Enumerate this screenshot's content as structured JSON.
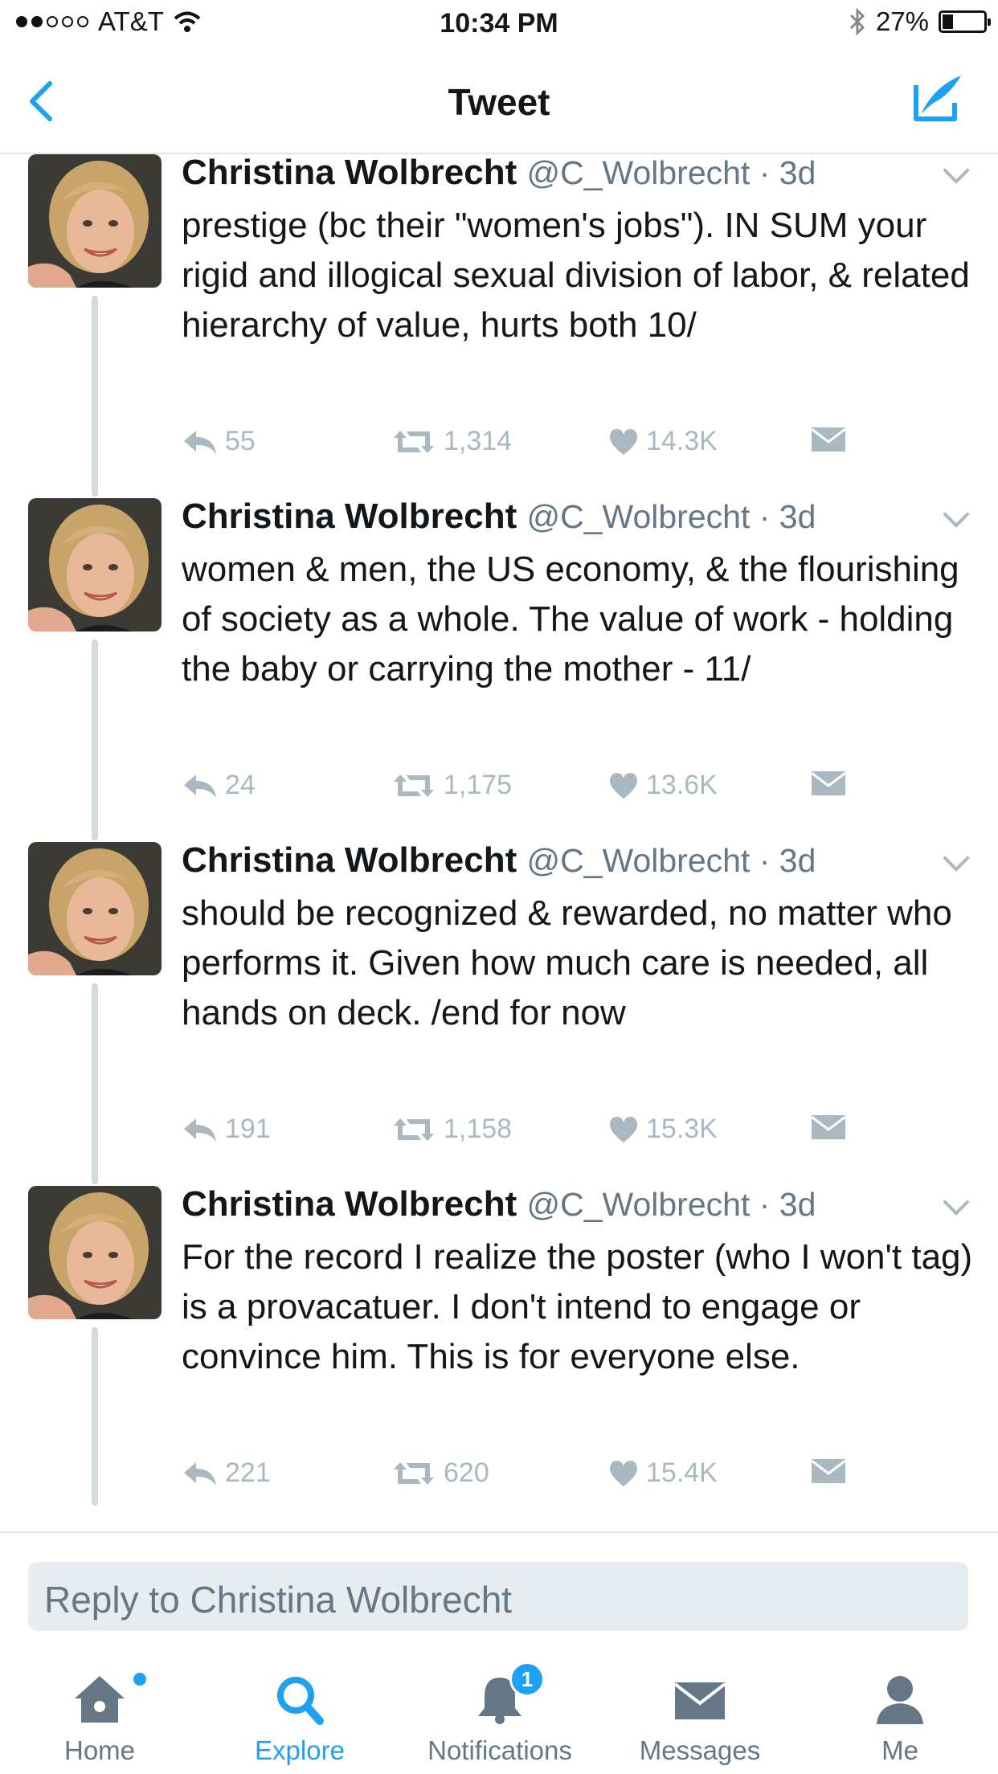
{
  "status_bar": {
    "carrier": "AT&T",
    "time": "10:34 PM",
    "battery": "27%"
  },
  "nav": {
    "title": "Tweet"
  },
  "tweets": [
    {
      "name": "Christina Wolbrecht",
      "handle": "@C_Wolbrecht",
      "time": "3d",
      "text": "prestige (bc their \"women's jobs\"). IN SUM your rigid and illogical sexual division of labor, & related hierarchy of value, hurts both 10/",
      "replies": "55",
      "retweets": "1,314",
      "likes": "14.3K"
    },
    {
      "name": "Christina Wolbrecht",
      "handle": "@C_Wolbrecht",
      "time": "3d",
      "text": "women & men, the US economy, & the flourishing of society as a whole. The value of work - holding the baby or carrying the mother - 11/",
      "replies": "24",
      "retweets": "1,175",
      "likes": "13.6K"
    },
    {
      "name": "Christina Wolbrecht",
      "handle": "@C_Wolbrecht",
      "time": "3d",
      "text": "should be recognized & rewarded, no matter who performs it. Given how much care is needed, all hands on deck. /end for now",
      "replies": "191",
      "retweets": "1,158",
      "likes": "15.3K"
    },
    {
      "name": "Christina Wolbrecht",
      "handle": "@C_Wolbrecht",
      "time": "3d",
      "text": "For the record I realize the poster (who I won't tag) is a provacatuer. I don't intend to engage or convince him. This is for everyone else.",
      "replies": "221",
      "retweets": "620",
      "likes": "15.4K"
    }
  ],
  "reply": {
    "placeholder": "Reply to Christina Wolbrecht"
  },
  "tab_bar": {
    "home": "Home",
    "explore": "Explore",
    "notifications": "Notifications",
    "notifications_badge": "1",
    "messages": "Messages",
    "me": "Me"
  },
  "colors": {
    "accent": "#1da1f2",
    "secondary_text": "#657786",
    "action_icons": "#aab8c2"
  }
}
